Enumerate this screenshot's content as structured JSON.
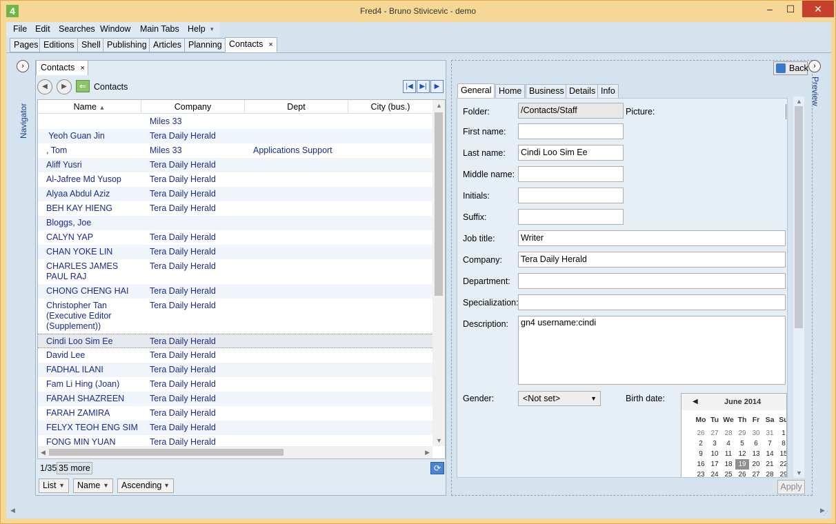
{
  "window": {
    "title": "Fred4 - Bruno Stivicevic - demo",
    "app_icon": "4",
    "minimize": "–",
    "maximize": "☐",
    "close": "✕"
  },
  "menu": {
    "items": [
      "File",
      "Edit",
      "Searches",
      "Window",
      "Main Tabs",
      "Help"
    ]
  },
  "main_tabs": [
    "Pages",
    "Editions",
    "Shell",
    "Publishing",
    "Articles",
    "Planning",
    "Contacts"
  ],
  "sidebar": {
    "navigator_label": "Navigator",
    "preview_label": "Preview"
  },
  "contacts_panel": {
    "tab_label": "Contacts",
    "breadcrumb": "Contacts",
    "columns": [
      "Name",
      "Company",
      "Dept",
      "City (bus.)"
    ],
    "rows": [
      {
        "name": "",
        "company": "Miles 33",
        "dept": ""
      },
      {
        "name": " Yeoh Guan Jin",
        "company": "Tera Daily Herald",
        "dept": ""
      },
      {
        "name": ", Tom",
        "company": "Miles 33",
        "dept": "Applications Support"
      },
      {
        "name": "Aliff Yusri",
        "company": "Tera Daily Herald",
        "dept": ""
      },
      {
        "name": "Al-Jafree Md Yusop",
        "company": "Tera Daily Herald",
        "dept": ""
      },
      {
        "name": "Alyaa Abdul Aziz",
        "company": "Tera Daily Herald",
        "dept": ""
      },
      {
        "name": "BEH KAY HIENG",
        "company": "Tera Daily Herald",
        "dept": ""
      },
      {
        "name": "Bloggs, Joe",
        "company": "",
        "dept": ""
      },
      {
        "name": "CALYN YAP",
        "company": "Tera Daily Herald",
        "dept": ""
      },
      {
        "name": "CHAN YOKE LIN",
        "company": "Tera Daily Herald",
        "dept": ""
      },
      {
        "name": "CHARLES JAMES PAUL RAJ",
        "company": "Tera Daily Herald",
        "dept": ""
      },
      {
        "name": "CHONG CHENG HAI",
        "company": "Tera Daily Herald",
        "dept": ""
      },
      {
        "name": "Christopher Tan (Executive Editor (Supplement))",
        "company": "Tera Daily Herald",
        "dept": ""
      },
      {
        "name": "Cindi Loo Sim Ee",
        "company": "Tera Daily Herald",
        "dept": ""
      },
      {
        "name": "David Lee",
        "company": "Tera Daily Herald",
        "dept": ""
      },
      {
        "name": "FADHAL ILANI",
        "company": "Tera Daily Herald",
        "dept": ""
      },
      {
        "name": "Fam Li Hing (Joan)",
        "company": "Tera Daily Herald",
        "dept": ""
      },
      {
        "name": "FARAH SHAZREEN",
        "company": "Tera Daily Herald",
        "dept": ""
      },
      {
        "name": "FARAH ZAMIRA",
        "company": "Tera Daily Herald",
        "dept": ""
      },
      {
        "name": "FELYX TEOH ENG SIM",
        "company": "Tera Daily Herald",
        "dept": ""
      },
      {
        "name": "FONG MIN YUAN",
        "company": "Tera Daily Herald",
        "dept": ""
      }
    ],
    "status": "1/35",
    "more_label": "35 more",
    "view_mode": "List",
    "sort_field": "Name",
    "sort_order": "Ascending"
  },
  "detail_panel": {
    "back_label": "Back",
    "tabs": [
      "General",
      "Home",
      "Business",
      "Details",
      "Info"
    ],
    "labels": {
      "folder": "Folder:",
      "picture": "Picture:",
      "first_name": "First name:",
      "last_name": "Last name:",
      "middle_name": "Middle name:",
      "initials": "Initials:",
      "suffix": "Suffix:",
      "job_title": "Job title:",
      "company": "Company:",
      "department": "Department:",
      "specialization": "Specialization:",
      "description": "Description:",
      "gender": "Gender:",
      "birth_date": "Birth date:"
    },
    "values": {
      "folder": "/Contacts/Staff",
      "first_name": "",
      "last_name": "Cindi Loo Sim Ee",
      "middle_name": "",
      "initials": "",
      "suffix": "",
      "job_title": "Writer",
      "company": "Tera Daily Herald",
      "department": "",
      "specialization": "",
      "description": "gn4 username:cindi",
      "gender": "<Not set>"
    },
    "calendar": {
      "month": "June 2014",
      "dow": [
        "Mo",
        "Tu",
        "We",
        "Th",
        "Fr",
        "Sa",
        "Su"
      ],
      "weeks": [
        [
          "26",
          "27",
          "28",
          "29",
          "30",
          "31",
          "1"
        ],
        [
          "2",
          "3",
          "4",
          "5",
          "6",
          "7",
          "8"
        ],
        [
          "9",
          "10",
          "11",
          "12",
          "13",
          "14",
          "15"
        ],
        [
          "16",
          "17",
          "18",
          "19",
          "20",
          "21",
          "22"
        ],
        [
          "23",
          "24",
          "25",
          "26",
          "27",
          "28",
          "29"
        ]
      ],
      "today": "19"
    },
    "apply_label": "Apply"
  }
}
